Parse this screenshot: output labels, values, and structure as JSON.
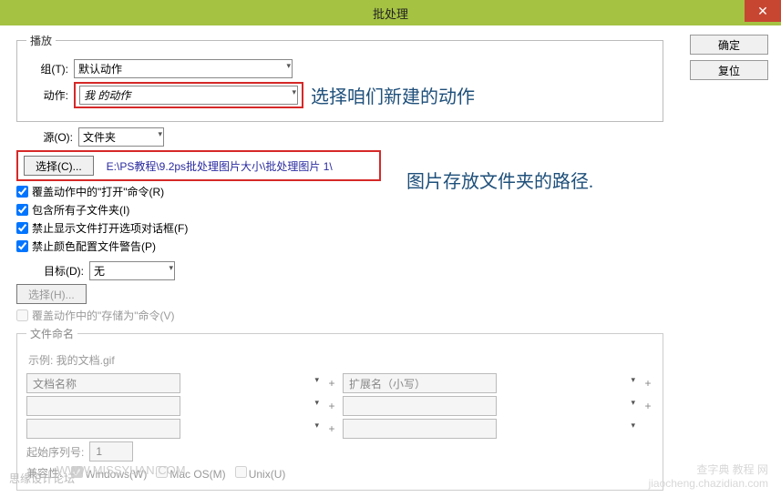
{
  "titlebar": {
    "title": "批处理",
    "close": "✕"
  },
  "buttons": {
    "ok": "确定",
    "reset": "复位"
  },
  "playback": {
    "legend": "播放",
    "group_label": "组(T):",
    "group_value": "默认动作",
    "action_label": "动作:",
    "action_value": "我 的动作"
  },
  "annotations": {
    "action": "选择咱们新建的动作",
    "path": "图片存放文件夹的路径."
  },
  "source": {
    "label": "源(O):",
    "value": "文件夹",
    "choose_btn": "选择(C)...",
    "path": "E:\\PS教程\\9.2ps批处理图片大小\\批处理图片 1\\",
    "cb1": "覆盖动作中的\"打开\"命令(R)",
    "cb2": "包含所有子文件夹(I)",
    "cb3": "禁止显示文件打开选项对话框(F)",
    "cb4": "禁止颜色配置文件警告(P)"
  },
  "dest": {
    "label": "目标(D):",
    "value": "无",
    "choose_btn": "选择(H)...",
    "cb_override": "覆盖动作中的\"存储为\"命令(V)"
  },
  "naming": {
    "legend": "文件命名",
    "example": "示例: 我的文档.gif",
    "field1": "文档名称",
    "field2": "扩展名（小写）",
    "seq_label": "起始序列号:",
    "seq_value": "1",
    "plus": "+",
    "compat_label": "兼容性:",
    "win": "Windows(W)",
    "mac": "Mac OS(M)",
    "unix": "Unix(U)"
  },
  "footer": {
    "left": "思缘设计论坛",
    "wm1": "WWW.MISSYUAN.COM",
    "wm2a": "查字典 教程 网",
    "wm2b": "jiaocheng.chazidian.com"
  }
}
